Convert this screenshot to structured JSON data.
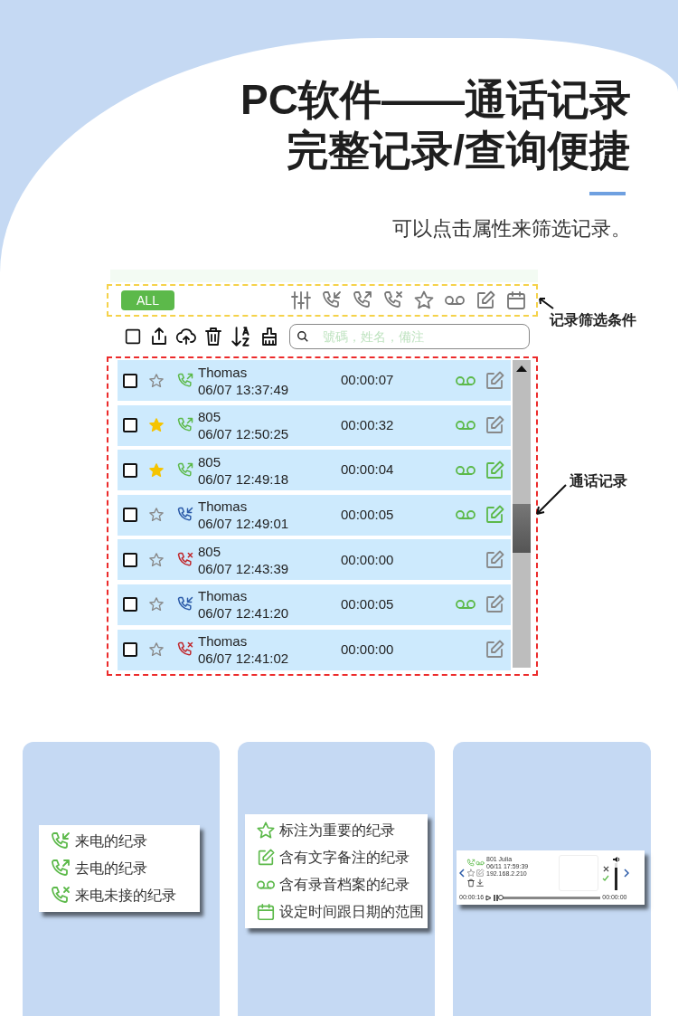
{
  "headline": [
    "PC软件——通话记录",
    "完整记录/查询便捷"
  ],
  "subtitle": "可以点击属性来筛选记录。",
  "app": {
    "filter_bar": {
      "all_button": "ALL"
    },
    "search": {
      "placeholder": "號碼，姓名，備注"
    },
    "calls": [
      {
        "kind": "outgoing",
        "checked": false,
        "starred": false,
        "name": "Thomas",
        "time": "06/07 13:37:49",
        "duration": "00:00:07",
        "has_recording": true,
        "has_note": false
      },
      {
        "kind": "outgoing",
        "checked": false,
        "starred": true,
        "name": "805",
        "time": "06/07 12:50:25",
        "duration": "00:00:32",
        "has_recording": true,
        "has_note": false
      },
      {
        "kind": "outgoing",
        "checked": false,
        "starred": true,
        "name": "805",
        "time": "06/07 12:49:18",
        "duration": "00:00:04",
        "has_recording": true,
        "has_note": true
      },
      {
        "kind": "incoming",
        "checked": false,
        "starred": false,
        "name": "Thomas",
        "time": "06/07 12:49:01",
        "duration": "00:00:05",
        "has_recording": true,
        "has_note": true
      },
      {
        "kind": "missed",
        "checked": false,
        "starred": false,
        "name": "805",
        "time": "06/07 12:43:39",
        "duration": "00:00:00",
        "has_recording": false,
        "has_note": false
      },
      {
        "kind": "incoming",
        "checked": false,
        "starred": false,
        "name": "Thomas",
        "time": "06/07 12:41:20",
        "duration": "00:00:05",
        "has_recording": true,
        "has_note": false
      },
      {
        "kind": "missed",
        "checked": false,
        "starred": false,
        "name": "Thomas",
        "time": "06/07 12:41:02",
        "duration": "00:00:00",
        "has_recording": false,
        "has_note": false
      }
    ]
  },
  "annotations": [
    "记录筛选条件",
    "通话记录"
  ],
  "legend_call_types": [
    {
      "kind": "incoming",
      "text": "来电的纪录"
    },
    {
      "kind": "outgoing",
      "text": "去电的纪录"
    },
    {
      "kind": "missed",
      "text": "来电未接的纪录"
    }
  ],
  "legend_attributes": [
    {
      "kind": "star",
      "text": "标注为重要的纪录"
    },
    {
      "kind": "note",
      "text": "含有文字备注的纪录"
    },
    {
      "kind": "recording",
      "text": "含有录音档案的纪录"
    },
    {
      "kind": "calendar",
      "text": "设定时间跟日期的范围"
    }
  ],
  "player": {
    "name": "801 Julia",
    "time": "06/11 17:59:39",
    "address": "192.168.2.210",
    "elapsed": "00:00:16",
    "total": "00:00:00",
    "progress": {
      "level": 0
    },
    "volume": {
      "level": 0.85
    }
  }
}
